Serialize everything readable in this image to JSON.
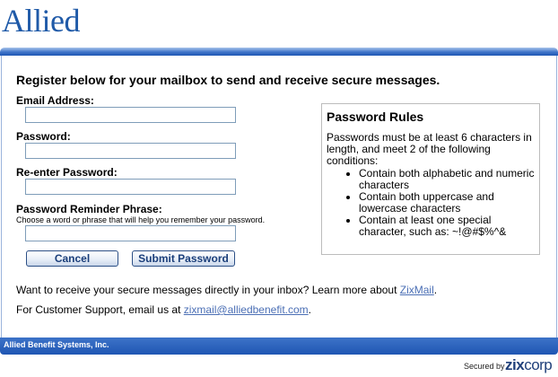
{
  "brand": {
    "logo_text": "Allied"
  },
  "form": {
    "headline": "Register below for your mailbox to send and receive secure messages.",
    "email_label": "Email Address:",
    "email_value": "",
    "password_label": "Password:",
    "password_value": "",
    "reenter_label": "Re-enter Password:",
    "reenter_value": "",
    "reminder_label": "Password Reminder Phrase:",
    "reminder_hint": "Choose a word or phrase that will help you remember your password.",
    "reminder_value": "",
    "cancel_label": "Cancel",
    "submit_label": "Submit Password"
  },
  "rules": {
    "title": "Password Rules",
    "intro": "Passwords must be at least 6 characters in length, and meet 2 of the following conditions:",
    "items": [
      "Contain both alphabetic and numeric characters",
      "Contain both uppercase and lowercase characters",
      "Contain at least one special character, such as: ~!@#$%^&"
    ]
  },
  "info": {
    "zixmail_text": "Want to receive your secure messages directly in your inbox? Learn more about ",
    "zixmail_link": "ZixMail",
    "zixmail_suffix": ".",
    "support_text": "For Customer Support, email us at ",
    "support_link": "zixmail@alliedbenefit.com",
    "support_suffix": "."
  },
  "footer": {
    "company": "Allied Benefit Systems, Inc.",
    "secured_by": "Secured by",
    "zix_a": "zix",
    "zix_b": "corp"
  },
  "colors": {
    "brand_blue": "#1f5aa8",
    "bar_blue": "#1f56b3",
    "link_blue": "#4b6fb5"
  }
}
